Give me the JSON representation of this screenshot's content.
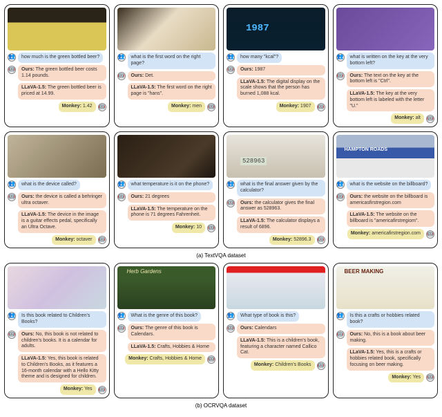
{
  "captions": {
    "a": "(a) TextVQA dataset",
    "b": "(b) OCRVQA dataset"
  },
  "labels": {
    "ours": "Ours:",
    "llava": "LLaVA-1.5:",
    "monkey": "Monkey:"
  },
  "cards_a": [
    {
      "q": "how much is the green bottled beer?",
      "ours": "The green bottled beer costs 1.14 pounds.",
      "llava": "The green bottled beer is priced at 14.99.",
      "monkey": "1.42"
    },
    {
      "q": "what is the first word on the right page?",
      "ours": "Det.",
      "llava": "The first word on the right page is \"hans\".",
      "monkey": "men"
    },
    {
      "q": "how many \"kcal\"?",
      "ours": "1987",
      "llava": "The digital display on the scale shows that the person has burned 1,088 kcal.",
      "monkey": "1907"
    },
    {
      "q": "what is written on the key at the very bottom left?",
      "ours": "The text on the key at the bottom left is \"Ctrl\".",
      "llava": "The key at the very bottom left is labeled with the letter \"U.\"",
      "monkey": "alt"
    },
    {
      "q": "what is the device called?",
      "ours": "the device is called a behringer ultra octaver.",
      "llava": "The device in the image is a guitar effects pedal, specifically an Ultra Octave.",
      "monkey": "octaver"
    },
    {
      "q": "what temperature is it on the phone?",
      "ours": "21 degrees",
      "llava": "The temperature on the phone is 71 degrees Fahrenheit.",
      "monkey": "10"
    },
    {
      "q": "what is the final answer given by the calculator?",
      "ours": "the calculator gives the final answer as 528963.",
      "llava": "The calculator displays a result of 6896.",
      "monkey": "52896.3"
    },
    {
      "q": "what is the website on the billboard?",
      "ours": "the website on the billboard is americasfirstregion.com",
      "llava": "The website on the billboard is \"americafirstregiom\".",
      "monkey": "americafirstregion.com"
    }
  ],
  "cards_b": [
    {
      "q": "Is this book related to Children's Books?",
      "ours": "No, this book is not related to children's books. It is a calendar for adults.",
      "llava": "Yes, this book is related to Children's Books, as it features a 16-month calendar with a Hello Kitty theme and is designed for children.",
      "monkey": "Yes"
    },
    {
      "q": "What is the genre of this book?",
      "ours": "The genre of this book is Calendars.",
      "llava": "Crafts, Hobbies & Home",
      "monkey": "Crafts, Hobbies & Home"
    },
    {
      "q": "What type of book is this?",
      "ours": "Calendars",
      "llava": "This is a children's book, featuring a character named Callico Cat.",
      "monkey": "Children's Books"
    },
    {
      "q": "Is this a crafts or hobbies related book?",
      "ours": "No, this is a book about beer making.",
      "llava": "Yes, this is a crafts or hobbies related book, specifically focusing on beer making.",
      "monkey": "Yes"
    }
  ]
}
